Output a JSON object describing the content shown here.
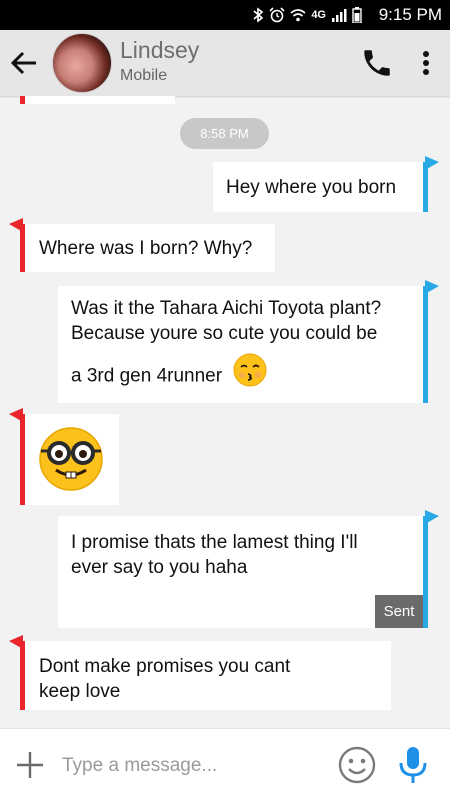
{
  "status_bar": {
    "network_label": "4G",
    "time": "9:15 PM",
    "icons": [
      "bluetooth-icon",
      "alarm-icon",
      "wifi-icon",
      "signal-icon",
      "battery-icon"
    ]
  },
  "header": {
    "contact_name": "Lindsey",
    "contact_subtitle": "Mobile",
    "icons": [
      "back-arrow-icon",
      "phone-icon",
      "more-vert-icon"
    ]
  },
  "conversation": {
    "timestamp": "8:58 PM",
    "messages": [
      {
        "direction": "outgoing",
        "text": "Hey where you born"
      },
      {
        "direction": "incoming",
        "text": "Where was I born? Why?"
      },
      {
        "direction": "outgoing",
        "lines": [
          "Was it the Tahara Aichi Toyota plant?",
          "Because youre so cute you could be",
          "a 3rd gen 4runner"
        ],
        "emoji": "kissing-face-emoji"
      },
      {
        "direction": "incoming",
        "emoji": "nerd-face-emoji"
      },
      {
        "direction": "outgoing",
        "lines": [
          "I promise thats the lamest thing I'll",
          "ever say to you haha"
        ],
        "status": "Sent"
      },
      {
        "direction": "incoming",
        "lines": [
          "Dont make promises you cant",
          "keep love"
        ]
      }
    ]
  },
  "composer": {
    "placeholder": "Type a message...",
    "value": ""
  },
  "colors": {
    "incoming_accent": "#e8262b",
    "outgoing_accent": "#29a8e6",
    "mic_blue": "#1e90e6",
    "status_bar": "#000000",
    "header_bg": "#e6e6e6"
  }
}
